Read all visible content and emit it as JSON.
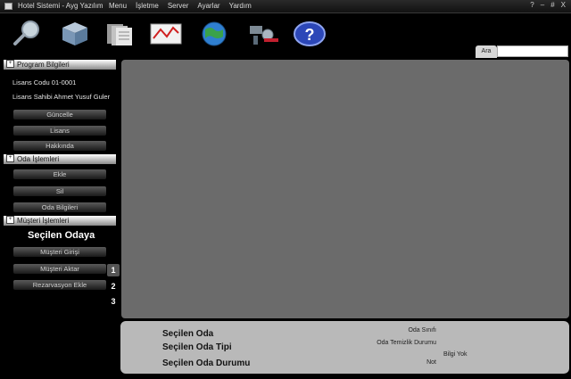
{
  "window": {
    "title": "Hotel Sistemi - Ayg Yazılım",
    "controls": [
      "?",
      "–",
      "#",
      "X"
    ]
  },
  "menu": [
    "Menu",
    "İşletme",
    "Server",
    "Ayarlar",
    "Yardım"
  ],
  "toolbar": {
    "icons": [
      "magnifier-icon",
      "cube-icon",
      "documents-icon",
      "chart-icon",
      "globe-icon",
      "tools-icon",
      "help-icon"
    ]
  },
  "search": {
    "tab_label": "Ara",
    "value": ""
  },
  "sidebar": {
    "program_header": "Program Bilgileri",
    "license_code": "Lisans Codu 01-0001",
    "license_owner": "Lisans Sahibi Ahmet Yusuf Guler",
    "update_btn": "Güncelle",
    "license_btn": "Lisans",
    "about_btn": "Hakkında",
    "room_header": "Oda İşlemleri",
    "add_btn": "Ekle",
    "delete_btn": "Sil",
    "room_info_btn": "Oda Bilgileri",
    "customer_header": "Müşteri İşlemleri",
    "selected_room_heading": "Seçilen Odaya",
    "checkin_btn": "Müşteri Girişi",
    "transfer_btn": "Müşteri Aktar",
    "reservation_btn": "Rezarvasyon Ekle",
    "pages": [
      "1",
      "2",
      "3"
    ]
  },
  "details": {
    "selected_room": "Seçilen Oda",
    "selected_room_type": "Seçilen Oda Tipi",
    "selected_room_status": "Seçilen Oda Durumu",
    "room_class": "Oda Sınıfı",
    "cleaning_status": "Oda Temizlik Durumu",
    "note": "Not",
    "no_info": "Bilgi Yok"
  }
}
